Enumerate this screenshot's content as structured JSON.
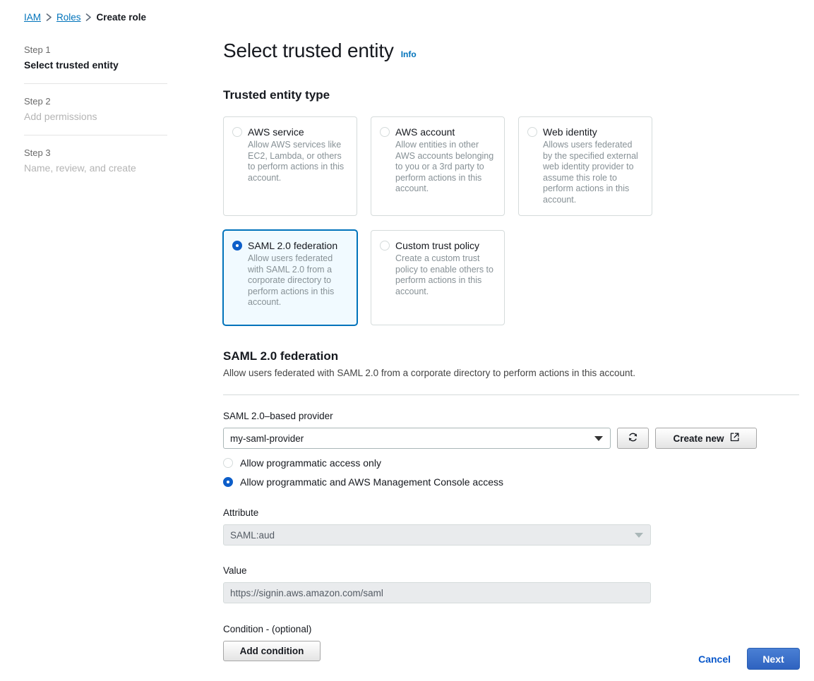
{
  "breadcrumb": {
    "items": [
      {
        "label": "IAM",
        "type": "link"
      },
      {
        "label": "Roles",
        "type": "link"
      },
      {
        "label": "Create role",
        "type": "current"
      }
    ]
  },
  "steps": [
    {
      "number": "Step 1",
      "title": "Select trusted entity",
      "state": "active"
    },
    {
      "number": "Step 2",
      "title": "Add permissions",
      "state": "inactive"
    },
    {
      "number": "Step 3",
      "title": "Name, review, and create",
      "state": "inactive"
    }
  ],
  "page": {
    "title": "Select trusted entity",
    "info_label": "Info"
  },
  "trusted_entity_type": {
    "heading": "Trusted entity type",
    "options": [
      {
        "label": "AWS service",
        "description": "Allow AWS services like EC2, Lambda, or others to perform actions in this account.",
        "selected": false
      },
      {
        "label": "AWS account",
        "description": "Allow entities in other AWS accounts belonging to you or a 3rd party to perform actions in this account.",
        "selected": false
      },
      {
        "label": "Web identity",
        "description": "Allows users federated by the specified external web identity provider to assume this role to perform actions in this account.",
        "selected": false
      },
      {
        "label": "SAML 2.0 federation",
        "description": "Allow users federated with SAML 2.0 from a corporate directory to perform actions in this account.",
        "selected": true
      },
      {
        "label": "Custom trust policy",
        "description": "Create a custom trust policy to enable others to perform actions in this account.",
        "selected": false
      }
    ]
  },
  "saml_section": {
    "heading": "SAML 2.0 federation",
    "description": "Allow users federated with SAML 2.0 from a corporate directory to perform actions in this account.",
    "provider": {
      "label": "SAML 2.0–based provider",
      "value": "my-saml-provider",
      "refresh_icon": "refresh-icon",
      "create_new_label": "Create new",
      "create_new_icon": "external-link-icon"
    },
    "access_options": [
      {
        "label": "Allow programmatic access only",
        "selected": false
      },
      {
        "label": "Allow programmatic and AWS Management Console access",
        "selected": true
      }
    ],
    "attribute": {
      "label": "Attribute",
      "value": "SAML:aud"
    },
    "value_field": {
      "label": "Value",
      "value": "https://signin.aws.amazon.com/saml"
    },
    "condition": {
      "label": "Condition - (optional)",
      "add_button_label": "Add condition"
    }
  },
  "footer": {
    "cancel_label": "Cancel",
    "next_label": "Next"
  },
  "colors": {
    "link": "#0073bb",
    "selected_card_bg": "#f1faff",
    "selected_card_border": "#0073bb",
    "radio_selected": "#0d5ec9",
    "primary_button": "#2f63c0"
  }
}
